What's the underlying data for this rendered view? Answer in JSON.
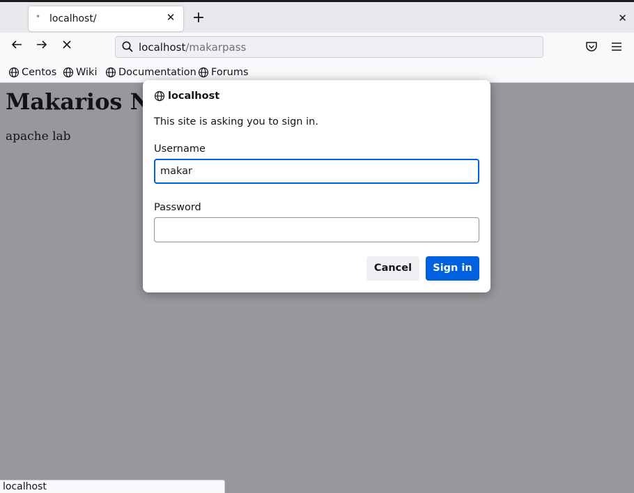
{
  "tab": {
    "title": "localhost/",
    "loading_indicator": "•"
  },
  "urlbar": {
    "host": "localhost",
    "path": "/makarpass"
  },
  "bookmarks": [
    {
      "label": "Centos"
    },
    {
      "label": "Wiki"
    },
    {
      "label": "Documentation"
    },
    {
      "label": "Forums"
    }
  ],
  "page": {
    "heading": "Makarios N",
    "paragraph": "apache lab"
  },
  "dialog": {
    "host": "localhost",
    "message": "This site is asking you to sign in.",
    "username_label": "Username",
    "username_value": "makar",
    "password_label": "Password",
    "password_value": "",
    "cancel_label": "Cancel",
    "signin_label": "Sign in"
  },
  "status": {
    "text": "localhost"
  },
  "colors": {
    "accent": "#0061e0",
    "overlay": "#919194"
  }
}
